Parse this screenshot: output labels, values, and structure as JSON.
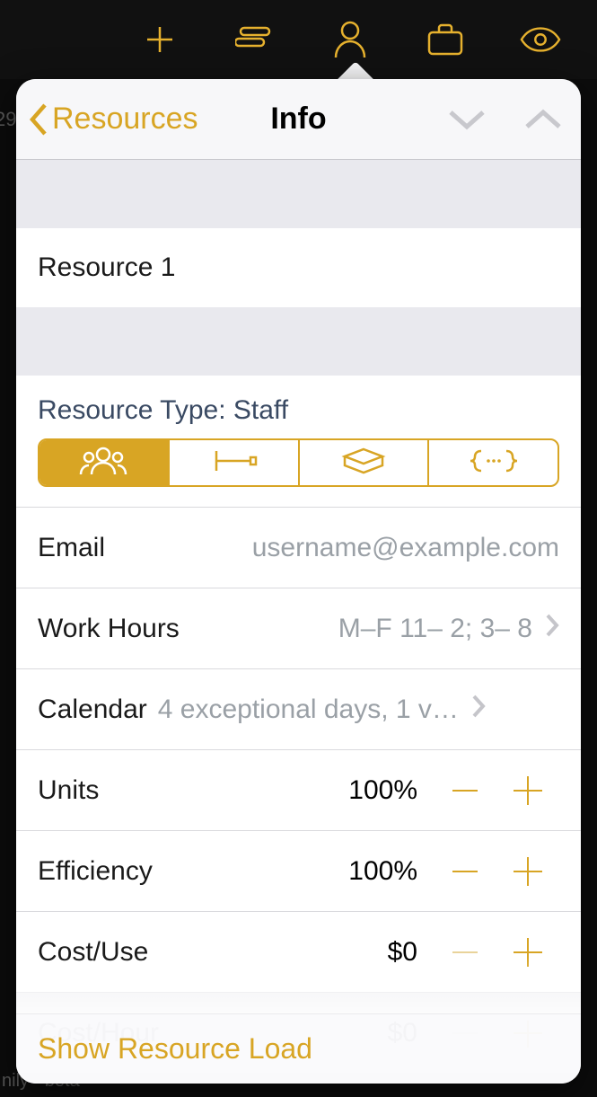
{
  "toolbar": {
    "icons": [
      "plus-icon",
      "lines-icon",
      "person-icon",
      "briefcase-icon",
      "eye-icon"
    ]
  },
  "header": {
    "back_label": "Resources",
    "title": "Info"
  },
  "resource": {
    "name": "Resource 1",
    "type_label": "Resource Type: Staff"
  },
  "fields": {
    "email_label": "Email",
    "email_placeholder": "username@example.com",
    "email_value": "",
    "workhours_label": "Work Hours",
    "workhours_value": "M–F 11– 2; 3– 8",
    "calendar_label": "Calendar",
    "calendar_value": "4 exceptional days, 1 v…",
    "units_label": "Units",
    "units_value": "100%",
    "efficiency_label": "Efficiency",
    "efficiency_value": "100%",
    "costuse_label": "Cost/Use",
    "costuse_value": "$0",
    "costhour_label": "Cost/Hour",
    "costhour_value": "$0"
  },
  "footer": {
    "show_load": "Show Resource Load"
  },
  "segments": [
    "staff",
    "equipment",
    "material",
    "group"
  ],
  "segment_active": 0,
  "backdrop": {
    "left_num": "29",
    "bottom_text": "nily · beta"
  }
}
